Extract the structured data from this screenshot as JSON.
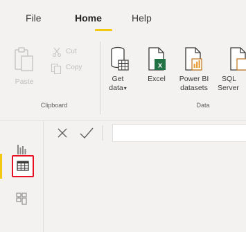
{
  "menu": {
    "tabs": [
      {
        "label": "File"
      },
      {
        "label": "Home"
      },
      {
        "label": "Help"
      }
    ]
  },
  "ribbon": {
    "clipboard": {
      "group_label": "Clipboard",
      "paste_label": "Paste",
      "cut_label": "Cut",
      "copy_label": "Copy"
    },
    "data": {
      "group_label": "Data",
      "get_data_line1": "Get",
      "get_data_line2": "data",
      "excel_label": "Excel",
      "pbi_line1": "Power BI",
      "pbi_line2": "datasets",
      "sql_line1": "SQL",
      "sql_line2": "Server"
    }
  },
  "formula_bar": {
    "value": ""
  },
  "views": {
    "active": "data"
  },
  "colors": {
    "accent": "#f2c811",
    "excel_green": "#217346",
    "highlight_red": "#e81123"
  }
}
